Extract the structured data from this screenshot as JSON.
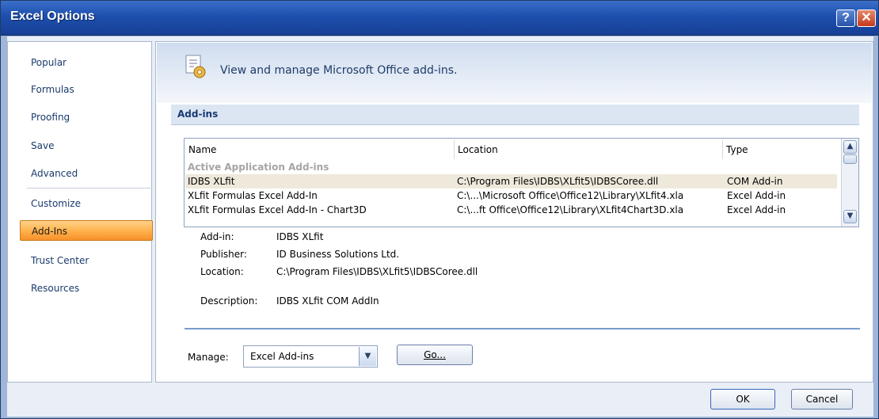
{
  "window": {
    "title": "Excel Options"
  },
  "sidebar": {
    "items": [
      {
        "label": "Popular"
      },
      {
        "label": "Formulas"
      },
      {
        "label": "Proofing"
      },
      {
        "label": "Save"
      },
      {
        "label": "Advanced"
      },
      {
        "label": "Customize"
      },
      {
        "label": "Add-Ins"
      },
      {
        "label": "Trust Center"
      },
      {
        "label": "Resources"
      }
    ],
    "selected": "Add-Ins"
  },
  "header": {
    "text": "View and manage Microsoft Office add-ins."
  },
  "section": {
    "title": "Add-ins"
  },
  "list": {
    "columns": [
      "Name",
      "Location",
      "Type"
    ],
    "group": "Active Application Add-ins",
    "rows": [
      {
        "name": "IDBS XLfit",
        "location": "C:\\Program Files\\IDBS\\XLfit5\\IDBSCoree.dll",
        "type": "COM Add-in"
      },
      {
        "name": "XLfit Formulas Excel Add-In",
        "location": "C:\\...\\Microsoft Office\\Office12\\Library\\XLfit4.xla",
        "type": "Excel Add-in"
      },
      {
        "name": "XLfit Formulas Excel Add-In - Chart3D",
        "location": "C:\\...ft Office\\Office12\\Library\\XLfit4Chart3D.xla",
        "type": "Excel Add-in"
      }
    ]
  },
  "details": {
    "addin_label": "Add-in:",
    "addin_value": "IDBS XLfit",
    "publisher_label": "Publisher:",
    "publisher_value": "ID Business Solutions Ltd.",
    "location_label": "Location:",
    "location_value": "C:\\Program Files\\IDBS\\XLfit5\\IDBSCoree.dll",
    "description_label": "Description:",
    "description_value": "IDBS XLfit COM AddIn"
  },
  "manage": {
    "label": "Manage:",
    "selected": "Excel Add-ins",
    "go_label": "Go..."
  },
  "footer": {
    "ok_label": "OK",
    "cancel_label": "Cancel"
  },
  "colors": {
    "title_bar": "#1d4fae",
    "selected_nav": "#ffb04a",
    "accent": "#7a9bd0"
  }
}
